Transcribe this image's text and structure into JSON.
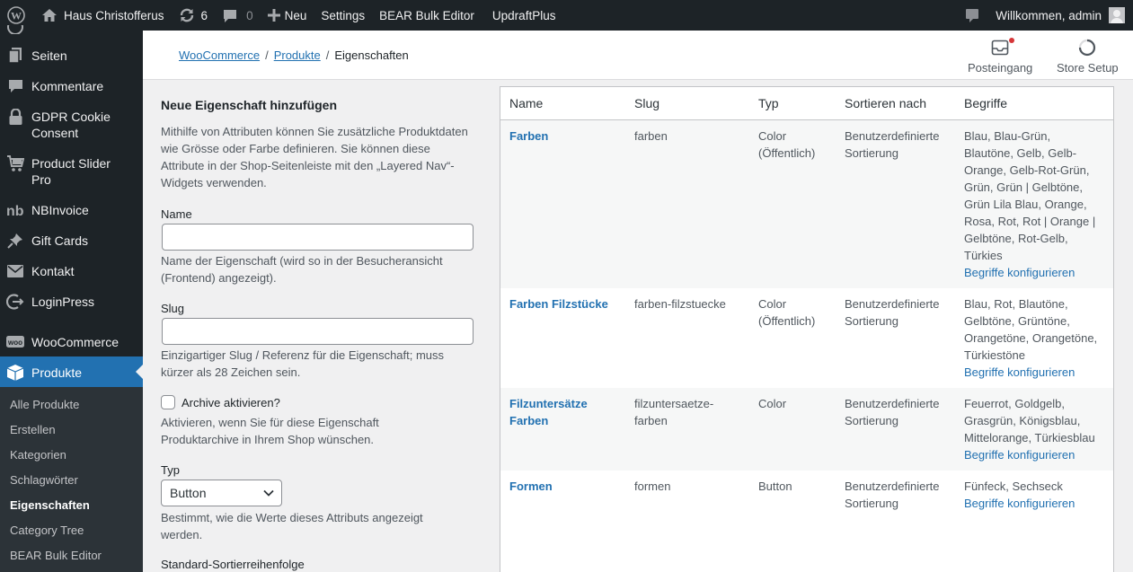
{
  "admin_bar": {
    "site_name": "Haus Christofferus",
    "updates_count": "6",
    "comments_count": "0",
    "new_label": "Neu",
    "settings_label": "Settings",
    "bear_label": "BEAR Bulk Editor",
    "updraft_label": "UpdraftPlus",
    "welcome": "Willkommen, admin"
  },
  "sidebar": {
    "items": [
      {
        "label": "Seiten",
        "icon": "pages-icon"
      },
      {
        "label": "Kommentare",
        "icon": "comments-icon"
      },
      {
        "label": "GDPR Cookie Consent",
        "icon": "lock-icon"
      },
      {
        "label": "Product Slider Pro",
        "icon": "cart-icon"
      },
      {
        "label": "NBInvoice",
        "icon": "nb-icon"
      },
      {
        "label": "Gift Cards",
        "icon": "pin-icon"
      },
      {
        "label": "Kontakt",
        "icon": "mail-icon"
      },
      {
        "label": "LoginPress",
        "icon": "loginpress-icon"
      },
      {
        "label": "WooCommerce",
        "icon": "woo-icon"
      },
      {
        "label": "Produkte",
        "icon": "archive-icon"
      }
    ],
    "gdpr_line1": "GDPR Cookie",
    "gdpr_line2": "Consent",
    "slider_line1": "Product Slider",
    "slider_line2": "Pro",
    "submenu": [
      "Alle Produkte",
      "Erstellen",
      "Kategorien",
      "Schlagwörter",
      "Eigenschaften",
      "Category Tree",
      "BEAR Bulk Editor"
    ]
  },
  "header": {
    "breadcrumb": [
      "WooCommerce",
      "Produkte",
      "Eigenschaften"
    ],
    "inbox_label": "Posteingang",
    "setup_label": "Store Setup"
  },
  "form": {
    "title": "Neue Eigenschaft hinzufügen",
    "intro_lines": [
      "Mithilfe von Attributen können Sie zusätzliche Produktdaten",
      "wie Grösse oder Farbe definieren. Sie können diese",
      "Attribute in der Shop-Seitenleiste mit den „Layered Nav“-",
      "Widgets verwenden."
    ],
    "name_label": "Name",
    "name_value": "",
    "name_help_lines": [
      "Name der Eigenschaft (wird so in der Besucheransicht",
      "(Frontend) angezeigt)."
    ],
    "slug_label": "Slug",
    "slug_value": "",
    "slug_help_lines": [
      "Einzigartiger Slug / Referenz für die Eigenschaft; muss",
      "kürzer als 28 Zeichen sein."
    ],
    "archive_label": "Archive aktivieren?",
    "archive_help_lines": [
      "Aktivieren, wenn Sie für diese Eigenschaft",
      "Produktarchive in Ihrem Shop wünschen."
    ],
    "type_label": "Typ",
    "type_value": "Button",
    "type_help_lines": [
      "Bestimmt, wie die Werte dieses Attributs angezeigt",
      "werden."
    ],
    "sort_label": "Standard-Sortierreihenfolge"
  },
  "table": {
    "headers": [
      "Name",
      "Slug",
      "Typ",
      "Sortieren nach",
      "Begriffe"
    ],
    "configure_label": "Begriffe konfigurieren",
    "rows": [
      {
        "name": [
          "Farben"
        ],
        "slug": [
          "farben"
        ],
        "type": [
          "Color",
          "(Öffentlich)"
        ],
        "sort": [
          "Benutzerdefinierte",
          "Sortierung"
        ],
        "terms": [
          "Blau, Blau-Grün,",
          "Blautöne, Gelb, Gelb-",
          "Orange, Gelb-Rot-Grün,",
          "Grün, Grün | Gelbtöne,",
          "Grün Lila Blau, Orange,",
          "Rosa, Rot, Rot | Orange |",
          "Gelbtöne, Rot-Gelb,",
          "Türkies"
        ]
      },
      {
        "name": [
          "Farben Filzstücke"
        ],
        "slug": [
          "farben-filzstuecke"
        ],
        "type": [
          "Color",
          "(Öffentlich)"
        ],
        "sort": [
          "Benutzerdefinierte",
          "Sortierung"
        ],
        "terms": [
          "Blau, Rot, Blautöne,",
          "Gelbtöne, Grüntöne,",
          "Orangetöne, Orangetöne,",
          "Türkiestöne"
        ]
      },
      {
        "name": [
          "Filzuntersätze",
          "Farben"
        ],
        "slug": [
          "filzuntersaetze-",
          "farben"
        ],
        "type": [
          "Color"
        ],
        "sort": [
          "Benutzerdefinierte",
          "Sortierung"
        ],
        "terms": [
          "Feuerrot, Goldgelb,",
          "Grasgrün, Königsblau,",
          "Mittelorange, Türkiesblau"
        ]
      },
      {
        "name": [
          "Formen"
        ],
        "slug": [
          "formen"
        ],
        "type": [
          "Button"
        ],
        "sort": [
          "Benutzerdefinierte",
          "Sortierung"
        ],
        "terms": [
          "Fünfeck, Sechseck"
        ]
      }
    ]
  }
}
